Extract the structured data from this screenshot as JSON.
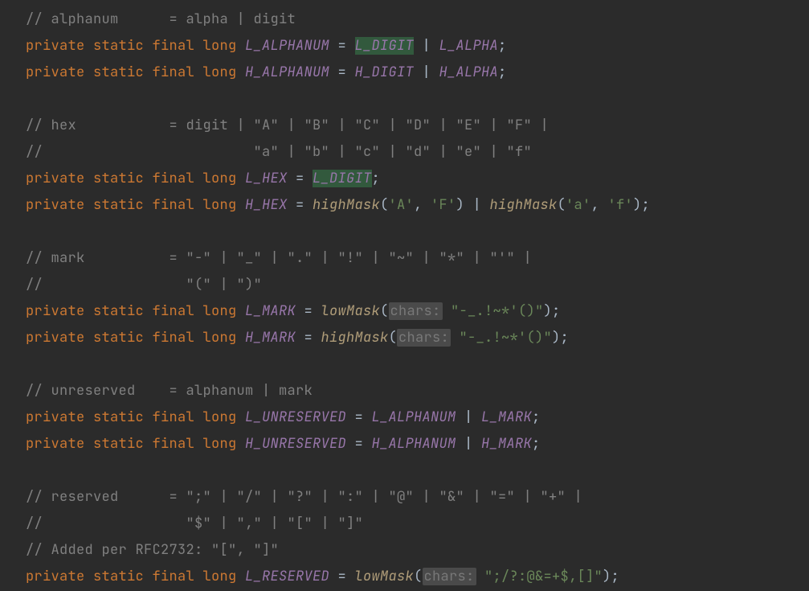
{
  "kw": {
    "private": "private",
    "static": "static",
    "final": "final",
    "long": "long"
  },
  "punct": {
    "eq": " = ",
    "pipe": " | ",
    "semi": ";",
    "lp": "(",
    "rp": ")",
    "c": ", "
  },
  "hint": {
    "chars": "chars:"
  },
  "fields": {
    "L_ALPHANUM": "L_ALPHANUM",
    "H_ALPHANUM": "H_ALPHANUM",
    "L_DIGIT": "L_DIGIT",
    "H_DIGIT": "H_DIGIT",
    "L_ALPHA": "L_ALPHA",
    "H_ALPHA": "H_ALPHA",
    "L_HEX": "L_HEX",
    "H_HEX": "H_HEX",
    "L_MARK": "L_MARK",
    "H_MARK": "H_MARK",
    "L_UNRESERVED": "L_UNRESERVED",
    "H_UNRESERVED": "H_UNRESERVED",
    "L_RESERVED": "L_RESERVED"
  },
  "methods": {
    "lowMask": "lowMask",
    "highMask": "highMask"
  },
  "strings": {
    "A": "'A'",
    "F": "'F'",
    "a": "'a'",
    "f": "'f'",
    "mark": "\"-_.!~*'()\"",
    "reserved": "\";/?:@&=+$,[]\""
  },
  "comments": {
    "alphanum": "// alphanum      = alpha | digit",
    "hex1": "// hex           = digit | \"A\" | \"B\" | \"C\" | \"D\" | \"E\" | \"F\" |",
    "hex2": "//                         \"a\" | \"b\" | \"c\" | \"d\" | \"e\" | \"f\"",
    "mark1": "// mark          = \"-\" | \"_\" | \".\" | \"!\" | \"~\" | \"*\" | \"'\" |",
    "mark2": "//                 \"(\" | \")\"",
    "unreserved": "// unreserved    = alphanum | mark",
    "reserved1": "// reserved      = \";\" | \"/\" | \"?\" | \":\" | \"@\" | \"&\" | \"=\" | \"+\" |",
    "reserved2": "//                 \"$\" | \",\" | \"[\" | \"]\"",
    "reserved3": "// Added per RFC2732: \"[\", \"]\""
  }
}
